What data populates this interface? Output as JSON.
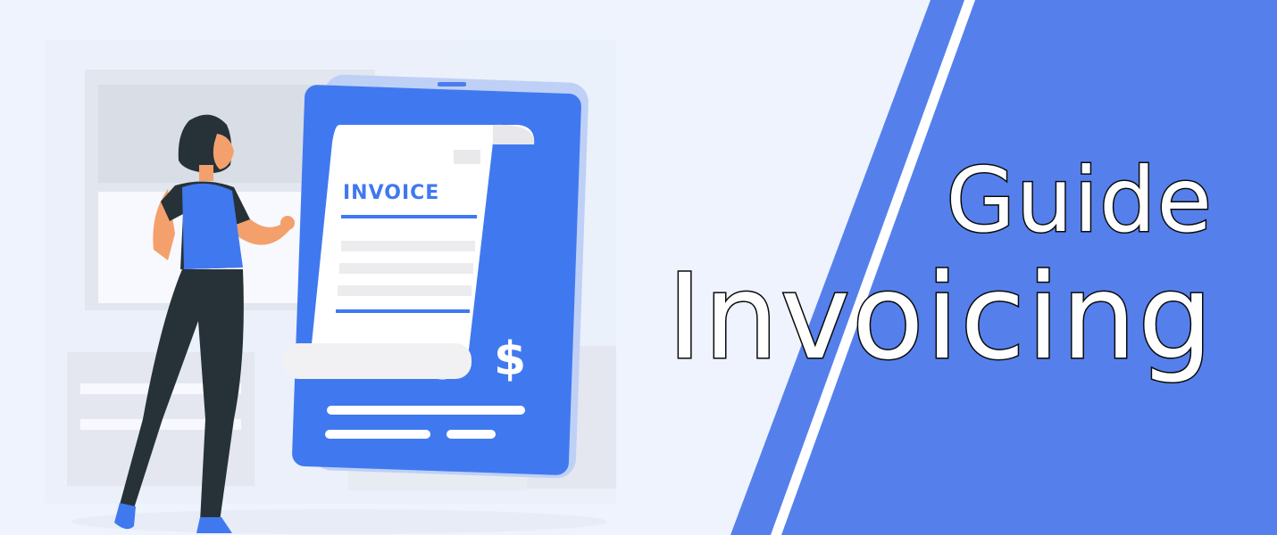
{
  "banner": {
    "title_line_1": "Guide",
    "title_line_2": "Invoicing",
    "invoice_label": "INVOICE",
    "currency_symbol": "$"
  },
  "colors": {
    "background": "#eef3fd",
    "panel": "#5580ec",
    "accent_blue": "#4079ef",
    "phone_frame": "#bfd0f7",
    "paper": "#ffffff",
    "outline_text": "#0b0b0b"
  },
  "icons": [
    "woman-figure",
    "phone-device",
    "invoice-receipt",
    "dollar-sign"
  ]
}
